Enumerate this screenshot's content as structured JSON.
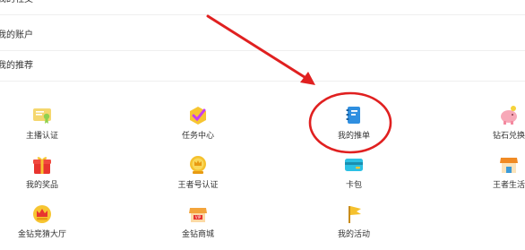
{
  "menu": {
    "social": "我的社交",
    "account": "我的账户",
    "recommend": "我的推荐"
  },
  "grid": [
    {
      "label": "主播认证",
      "icon": "certificate-icon"
    },
    {
      "label": "任务中心",
      "icon": "task-check-icon"
    },
    {
      "label": "我的推单",
      "icon": "notebook-icon"
    },
    {
      "label": "钻石兑换",
      "icon": "piggy-bank-icon"
    },
    {
      "label": "我的奖品",
      "icon": "gift-box-icon"
    },
    {
      "label": "王者号认证",
      "icon": "crown-badge-icon"
    },
    {
      "label": "卡包",
      "icon": "card-wallet-icon"
    },
    {
      "label": "王者生活",
      "icon": "store-icon"
    },
    {
      "label": "金钻竞猜大厅",
      "icon": "vip-crown-icon"
    },
    {
      "label": "金钻商城",
      "icon": "shop-icon"
    },
    {
      "label": "我的活动",
      "icon": "flag-icon"
    }
  ],
  "annotation_color": "#e02020"
}
